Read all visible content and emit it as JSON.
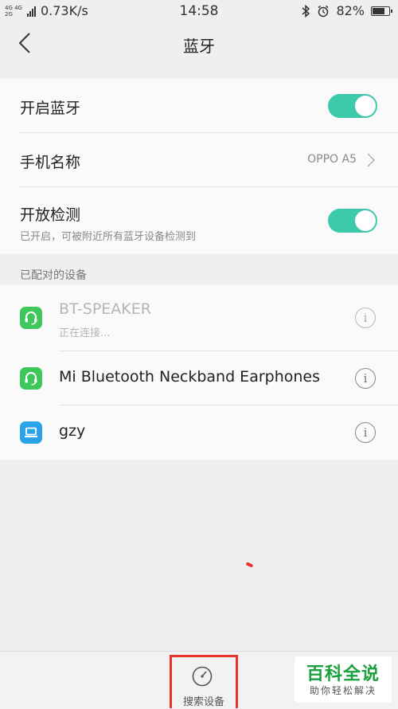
{
  "status_bar": {
    "network_top": "4G 4G",
    "network_bottom": "2G",
    "speed": "0.73K/s",
    "time": "14:58",
    "battery_percent_text": "82%",
    "battery_level": 0.82,
    "icons": [
      "signal-icon",
      "bluetooth-icon",
      "alarm-icon",
      "battery-icon"
    ]
  },
  "header": {
    "title": "蓝牙",
    "back_icon": "chevron-left-icon"
  },
  "settings": {
    "bluetooth": {
      "label": "开启蓝牙",
      "enabled": true
    },
    "device_name": {
      "label": "手机名称",
      "value": "OPPO A5"
    },
    "discoverable": {
      "label": "开放检测",
      "subtitle": "已开启，可被附近所有蓝牙设备检测到",
      "enabled": true
    }
  },
  "paired": {
    "section_label": "已配对的设备",
    "devices": [
      {
        "name": "BT-SPEAKER",
        "status": "正在连接...",
        "icon": "headset-icon"
      },
      {
        "name": "Mi Bluetooth Neckband Earphones",
        "icon": "headset-icon"
      },
      {
        "name": "gzy",
        "icon": "laptop-icon"
      }
    ]
  },
  "bottom": {
    "search_label": "搜索设备",
    "search_icon": "radar-search-icon"
  },
  "watermark": {
    "main": "百科全说",
    "sub": "助你轻松解决"
  },
  "colors": {
    "toggle_on": "#3cc9ac",
    "headset_icon_bg": "#3ec75a",
    "laptop_icon_bg": "#2aa3ea",
    "highlight": "#e8352b",
    "watermark_green": "#1aa03c"
  }
}
